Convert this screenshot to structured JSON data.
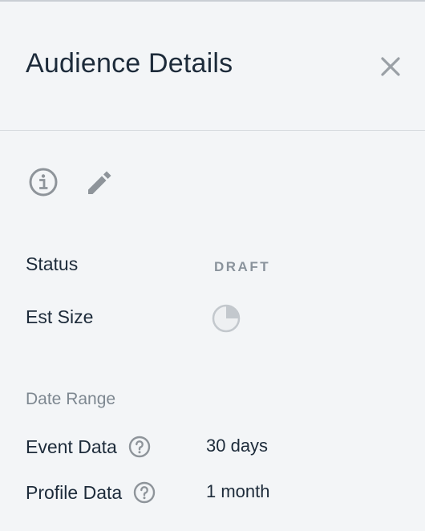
{
  "header": {
    "title": "Audience Details",
    "close_icon": "close-icon"
  },
  "toolbar": {
    "info_icon": "info-icon",
    "edit_icon": "pencil-icon"
  },
  "details": {
    "status_label": "Status",
    "status_value": "DRAFT",
    "est_size_label": "Est Size",
    "est_size_icon": "pie-chart-icon"
  },
  "date_range": {
    "section_label": "Date Range",
    "event_label": "Event Data",
    "event_value": "30 days",
    "profile_label": "Profile Data",
    "profile_value": "1 month",
    "help_icon": "question-circle-icon"
  },
  "colors": {
    "background": "#f3f5f7",
    "text": "#1d2b3a",
    "muted": "#8a939c",
    "icon": "#8e949a"
  }
}
